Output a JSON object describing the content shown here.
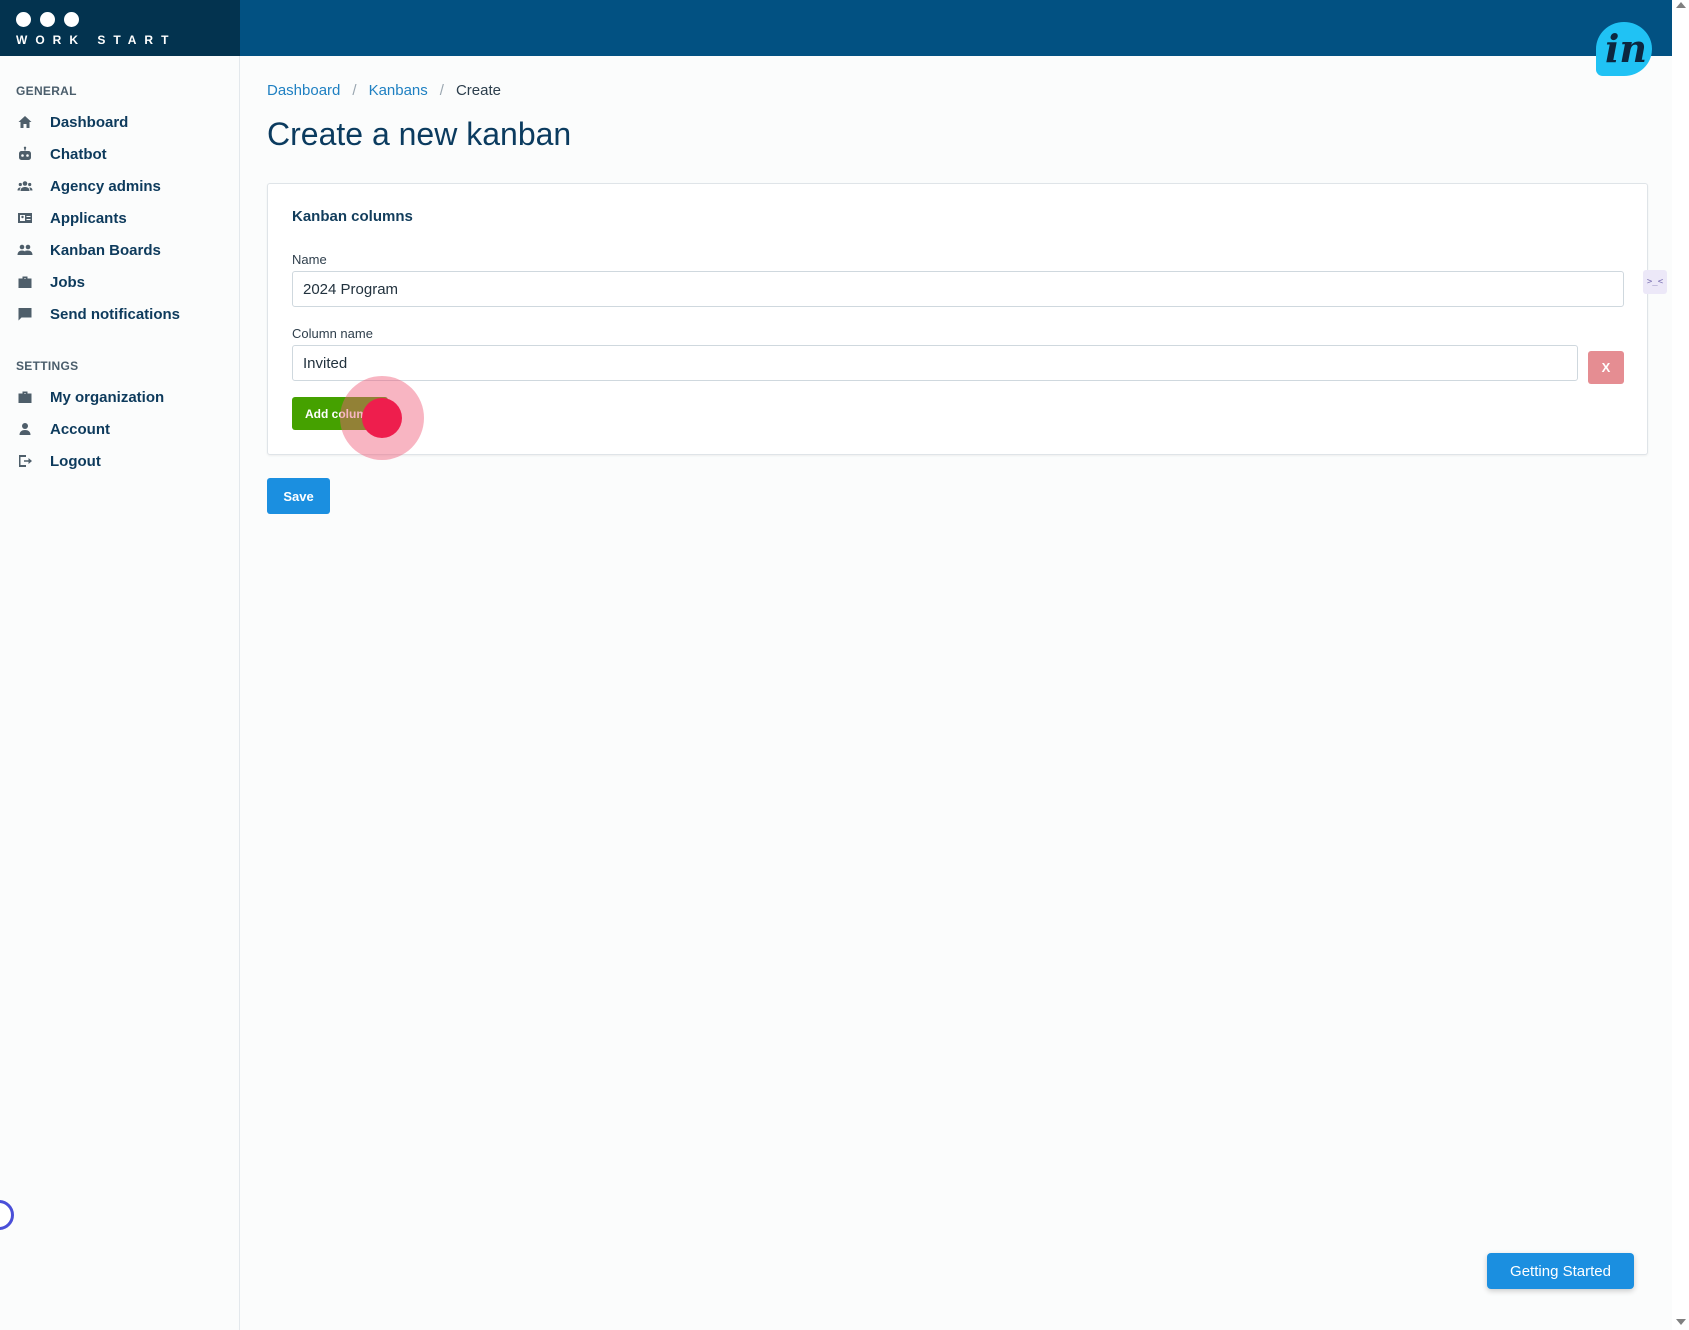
{
  "brand": {
    "word": "WORK START"
  },
  "badge": {
    "text": "in"
  },
  "sidebar": {
    "general_title": "GENERAL",
    "general_items": [
      {
        "label": "Dashboard",
        "icon": "home-icon"
      },
      {
        "label": "Chatbot",
        "icon": "robot-icon"
      },
      {
        "label": "Agency admins",
        "icon": "users-icon"
      },
      {
        "label": "Applicants",
        "icon": "id-card-icon"
      },
      {
        "label": "Kanban Boards",
        "icon": "users-icon"
      },
      {
        "label": "Jobs",
        "icon": "briefcase-icon"
      },
      {
        "label": "Send notifications",
        "icon": "message-icon"
      }
    ],
    "settings_title": "SETTINGS",
    "settings_items": [
      {
        "label": "My organization",
        "icon": "briefcase-icon"
      },
      {
        "label": "Account",
        "icon": "user-icon"
      },
      {
        "label": "Logout",
        "icon": "logout-icon"
      }
    ]
  },
  "breadcrumb": {
    "items": [
      "Dashboard",
      "Kanbans"
    ],
    "separator": "/",
    "current": "Create"
  },
  "page": {
    "title": "Create a new kanban"
  },
  "card": {
    "title": "Kanban columns",
    "name_label": "Name",
    "name_value": "2024 Program",
    "column_label": "Column name",
    "column_value": "Invited",
    "remove_label": "X",
    "add_label": "Add column"
  },
  "actions": {
    "save_label": "Save"
  },
  "widgets": {
    "side_widget_glyph": ">_<",
    "getting_started_label": "Getting Started"
  },
  "colors": {
    "topbar": "#025182",
    "brand_bg": "#03334f",
    "primary": "#1b8fe0",
    "success": "#45a100",
    "danger": "#e58d92",
    "click_indicator": "#ee1e4d"
  }
}
